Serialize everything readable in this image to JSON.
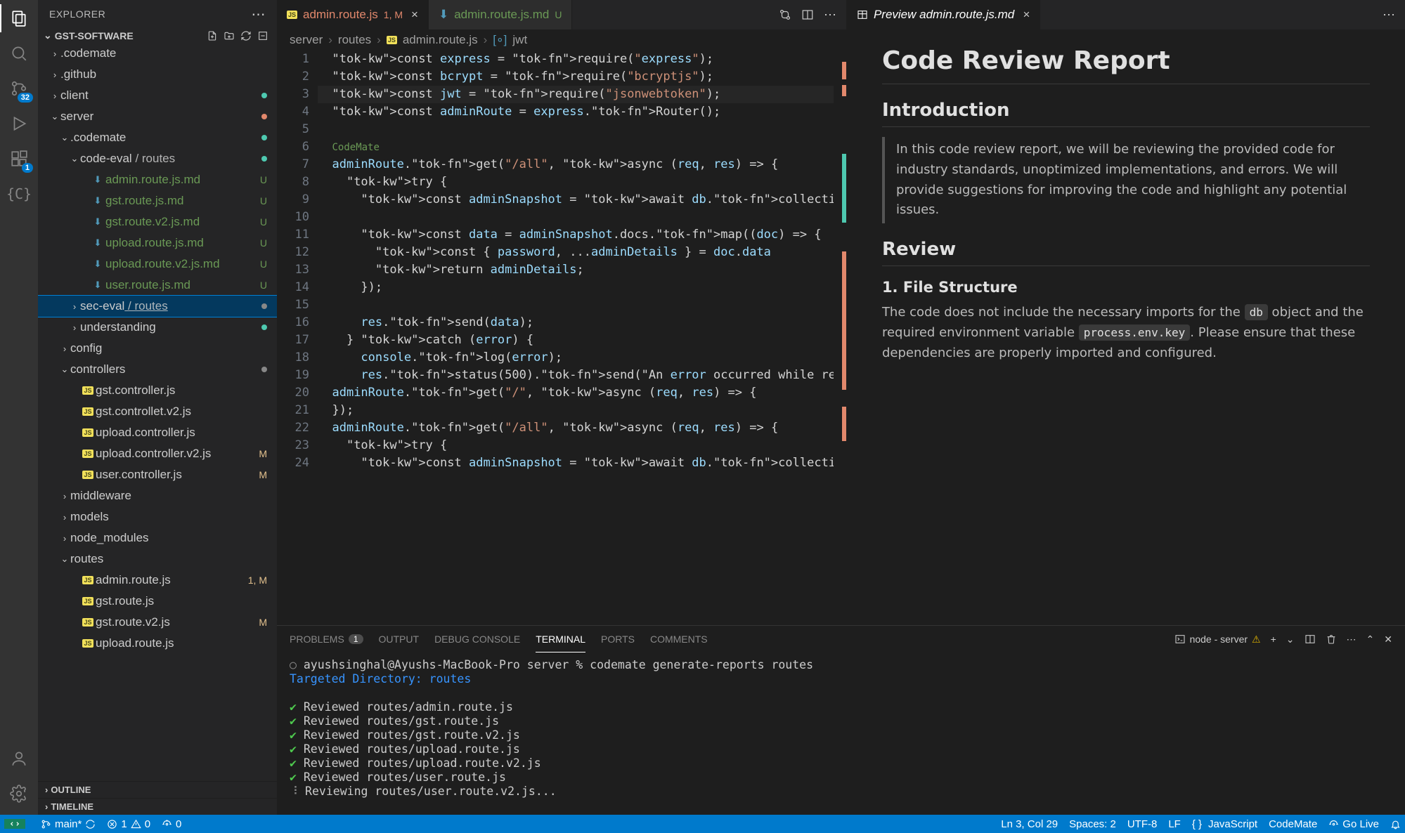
{
  "sidebar": {
    "title": "EXPLORER",
    "project": "GST-SOFTWARE",
    "outline": "OUTLINE",
    "timeline": "TIMELINE"
  },
  "badges": {
    "scm": "32",
    "ext": "1"
  },
  "tree": [
    {
      "depth": 0,
      "kind": "folder",
      "chev": "›",
      "label": ".codemate"
    },
    {
      "depth": 0,
      "kind": "folder",
      "chev": "›",
      "label": ".github"
    },
    {
      "depth": 0,
      "kind": "folder",
      "chev": "›",
      "label": "client",
      "dotColor": "#4ec9b0"
    },
    {
      "depth": 0,
      "kind": "folder",
      "chev": "⌄",
      "label": "server",
      "dotColor": "#e2886c",
      "labelClass": "folder-yellow"
    },
    {
      "depth": 1,
      "kind": "folder",
      "chev": "⌄",
      "label": ".codemate",
      "dotColor": "#4ec9b0"
    },
    {
      "depth": 2,
      "kind": "folder",
      "chev": "⌄",
      "label": "code-eval",
      "suffix": "/ routes",
      "dotColor": "#4ec9b0"
    },
    {
      "depth": 3,
      "kind": "file",
      "icon": "md",
      "label": "admin.route.js.md",
      "status": "U"
    },
    {
      "depth": 3,
      "kind": "file",
      "icon": "md",
      "label": "gst.route.js.md",
      "status": "U"
    },
    {
      "depth": 3,
      "kind": "file",
      "icon": "md",
      "label": "gst.route.v2.js.md",
      "status": "U"
    },
    {
      "depth": 3,
      "kind": "file",
      "icon": "md",
      "label": "upload.route.js.md",
      "status": "U"
    },
    {
      "depth": 3,
      "kind": "file",
      "icon": "md",
      "label": "upload.route.v2.js.md",
      "status": "U"
    },
    {
      "depth": 3,
      "kind": "file",
      "icon": "md",
      "label": "user.route.js.md",
      "status": "U"
    },
    {
      "depth": 2,
      "kind": "folder",
      "chev": "›",
      "label": "sec-eval",
      "suffix": "/ routes",
      "selected": true,
      "dotColor": "#888"
    },
    {
      "depth": 2,
      "kind": "folder",
      "chev": "›",
      "label": "understanding",
      "dotColor": "#4ec9b0"
    },
    {
      "depth": 1,
      "kind": "folder",
      "chev": "›",
      "label": "config"
    },
    {
      "depth": 1,
      "kind": "folder",
      "chev": "⌄",
      "label": "controllers",
      "dotColor": "#888",
      "labelClass": "folder-yellow"
    },
    {
      "depth": 2,
      "kind": "file",
      "icon": "js",
      "label": "gst.controller.js"
    },
    {
      "depth": 2,
      "kind": "file",
      "icon": "js",
      "label": "gst.controllet.v2.js"
    },
    {
      "depth": 2,
      "kind": "file",
      "icon": "js",
      "label": "upload.controller.js"
    },
    {
      "depth": 2,
      "kind": "file",
      "icon": "js",
      "label": "upload.controller.v2.js",
      "status": "M",
      "labelClass": "folder-yellow"
    },
    {
      "depth": 2,
      "kind": "file",
      "icon": "js",
      "label": "user.controller.js",
      "status": "M",
      "labelClass": "folder-yellow"
    },
    {
      "depth": 1,
      "kind": "folder",
      "chev": "›",
      "label": "middleware"
    },
    {
      "depth": 1,
      "kind": "folder",
      "chev": "›",
      "label": "models"
    },
    {
      "depth": 1,
      "kind": "folder",
      "chev": "›",
      "label": "node_modules",
      "labelClass": "text-dim"
    },
    {
      "depth": 1,
      "kind": "folder",
      "chev": "⌄",
      "label": "routes",
      "labelClass": "folder-yellow"
    },
    {
      "depth": 2,
      "kind": "file",
      "icon": "js",
      "label": "admin.route.js",
      "status": "1, M",
      "labelClass": "folder-yellow"
    },
    {
      "depth": 2,
      "kind": "file",
      "icon": "js",
      "label": "gst.route.js"
    },
    {
      "depth": 2,
      "kind": "file",
      "icon": "js",
      "label": "gst.route.v2.js",
      "status": "M",
      "labelClass": "folder-yellow"
    },
    {
      "depth": 2,
      "kind": "file",
      "icon": "js",
      "label": "upload.route.js",
      "labelClass": "text-dim"
    }
  ],
  "tabs": {
    "left": [
      {
        "icon": "JS",
        "label": "admin.route.js",
        "suffix": "1, M",
        "active": true,
        "close": "×",
        "labelColor": "#e2886c"
      },
      {
        "icon": "↓",
        "label": "admin.route.js.md",
        "suffix": "U",
        "active": false,
        "labelColor": "#6a9955"
      }
    ],
    "right": [
      {
        "icon": "▦",
        "label": "Preview admin.route.js.md",
        "active": true,
        "close": "×"
      }
    ]
  },
  "breadcrumb": {
    "parts": [
      "server",
      "routes",
      "admin.route.js",
      "jwt"
    ],
    "jsIcon": "JS",
    "varIcon": "[∘]"
  },
  "code": {
    "codemate": "CodeMate",
    "lines": [
      "const express = require(\"express\");",
      "const bcrypt = require(\"bcryptjs\");",
      "const jwt = require(\"jsonwebtoken\");",
      "const adminRoute = express.Router();",
      "",
      "",
      "adminRoute.get(\"/all\", async (req, res) => {",
      "  try {",
      "    const adminSnapshot = await db.collection(\"admin",
      "",
      "    const data = adminSnapshot.docs.map((doc) => {",
      "      const { password, ...adminDetails } = doc.data",
      "      return adminDetails;",
      "    });",
      "",
      "    res.send(data);",
      "  } catch (error) {",
      "    console.log(error);",
      "    res.status(500).send(\"An error occurred while re",
      "adminRoute.get(\"/\", async (req, res) => {",
      "});",
      "adminRoute.get(\"/all\", async (req, res) => {",
      "  try {",
      "    const adminSnapshot = await db.collection(\"admin"
    ]
  },
  "preview": {
    "h1": "Code Review Report",
    "h2a": "Introduction",
    "blockquote": "In this code review report, we will be reviewing the provided code for industry standards, unoptimized implementations, and errors. We will provide suggestions for improving the code and highlight any potential issues.",
    "h2b": "Review",
    "h3": "1. File Structure",
    "p1a": "The code does not include the necessary imports for the ",
    "code1": "db",
    "p1b": " object and the required environment variable ",
    "code2": "process.env.key",
    "p1c": ". Please ensure that these dependencies are properly imported and configured."
  },
  "panel": {
    "tabs": {
      "problems": "PROBLEMS",
      "problemsCount": "1",
      "output": "OUTPUT",
      "debug": "DEBUG CONSOLE",
      "terminal": "TERMINAL",
      "ports": "PORTS",
      "comments": "COMMENTS"
    },
    "termLabel": "node - server",
    "terminal": {
      "prompt": "ayushsinghal@Ayushs-MacBook-Pro server % codemate generate-reports routes",
      "target": "Targeted Directory: routes",
      "lines": [
        "Reviewed routes/admin.route.js",
        "Reviewed routes/gst.route.js",
        "Reviewed routes/gst.route.v2.js",
        "Reviewed routes/upload.route.js",
        "Reviewed routes/upload.route.v2.js",
        "Reviewed routes/user.route.js"
      ],
      "spinning": "Reviewing routes/user.route.v2.js..."
    }
  },
  "status": {
    "branch": "main*",
    "errors": "1",
    "warnings": "0",
    "ports": "0",
    "cursor": "Ln 3, Col 29",
    "spaces": "Spaces: 2",
    "encoding": "UTF-8",
    "eol": "LF",
    "lang": "JavaScript",
    "codemate": "CodeMate",
    "golive": "Go Live"
  }
}
